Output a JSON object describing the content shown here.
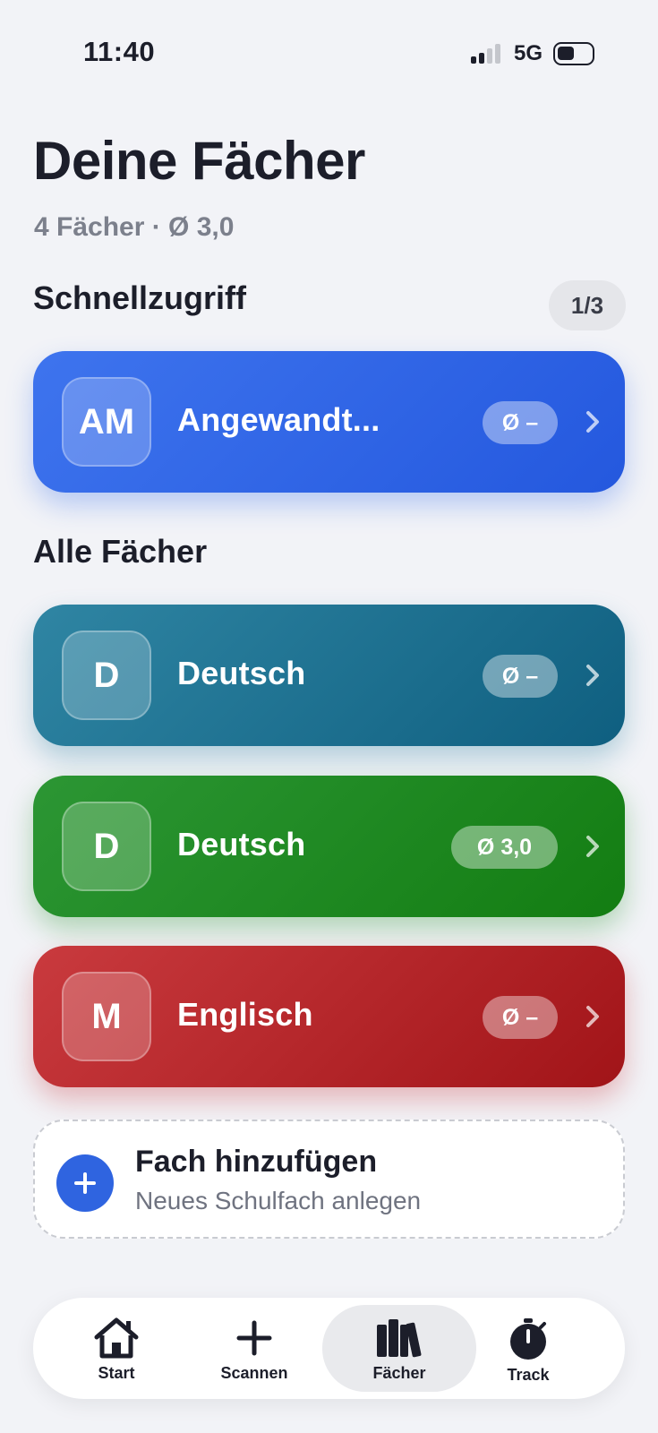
{
  "status_bar": {
    "time": "11:40",
    "network": "5G"
  },
  "header": {
    "title": "Deine Fächer",
    "subtitle": "4 Fächer · Ø 3,0"
  },
  "quick_access": {
    "title": "Schnellzugriff",
    "page_indicator": "1/3",
    "items": [
      {
        "initials": "AM",
        "name": "Angewandt...",
        "grade": "Ø –",
        "color_start": "#3e74ee",
        "color_end": "#2458de"
      }
    ]
  },
  "all_subjects": {
    "title": "Alle Fächer",
    "items": [
      {
        "initials": "D",
        "name": "Deutsch",
        "grade": "Ø –",
        "color_start": "#2f85a3",
        "color_end": "#0f5f80"
      },
      {
        "initials": "D",
        "name": "Deutsch",
        "grade": "Ø 3,0",
        "color_start": "#2c9634",
        "color_end": "#137d12"
      },
      {
        "initials": "M",
        "name": "Englisch",
        "grade": "Ø –",
        "color_start": "#c93a3e",
        "color_end": "#a11418"
      }
    ]
  },
  "add_subject": {
    "title": "Fach hinzufügen",
    "subtitle": "Neues Schulfach anlegen",
    "accent": "#2f64e0"
  },
  "tab_bar": {
    "active": "Fächer",
    "tabs": [
      {
        "label": "Start",
        "icon": "house-icon"
      },
      {
        "label": "Scannen",
        "icon": "plus-icon"
      },
      {
        "label": "Fächer",
        "icon": "books-icon"
      },
      {
        "label": "Track",
        "icon": "stopwatch-icon"
      }
    ]
  }
}
